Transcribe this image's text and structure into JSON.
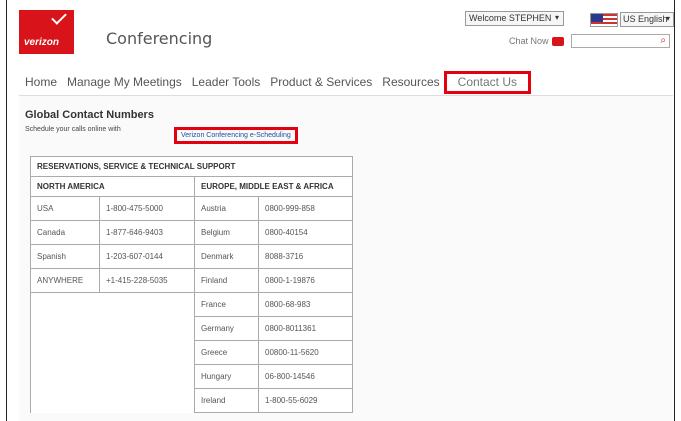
{
  "header": {
    "logo_text": "verizon",
    "app_title": "Conferencing",
    "welcome": "Welcome STEPHEN",
    "language": "US English",
    "chat": "Chat Now",
    "search_placeholder": ""
  },
  "nav": [
    "Home",
    "Manage My Meetings",
    "Leader Tools",
    "Product & Services",
    "Resources",
    "Contact Us"
  ],
  "page": {
    "title": "Global Contact Numbers",
    "schedule_text": "Schedule your calls online with",
    "schedule_link": "Verizon Conferencing e-Scheduling"
  },
  "table": {
    "main_header": "RESERVATIONS, SERVICE & TECHNICAL SUPPORT",
    "left_header": "NORTH AMERICA",
    "right_header": "EUROPE, MIDDLE EAST & AFRICA",
    "north_america": [
      {
        "region": "USA",
        "number": "1-800-475-5000"
      },
      {
        "region": "Canada",
        "number": "1-877-646-9403"
      },
      {
        "region": "Spanish",
        "number": "1-203-607-0144"
      },
      {
        "region": "ANYWHERE",
        "number": "+1-415-228-5035"
      }
    ],
    "emea": [
      {
        "region": "Austria",
        "number": "0800-999-858"
      },
      {
        "region": "Belgium",
        "number": "0800-40154"
      },
      {
        "region": "Denmark",
        "number": "8088-3716"
      },
      {
        "region": "Finland",
        "number": "0800-1-19876"
      },
      {
        "region": "France",
        "number": "0800-68-983"
      },
      {
        "region": "Germany",
        "number": "0800-8011361"
      },
      {
        "region": "Greece",
        "number": "00800-11-5620"
      },
      {
        "region": "Hungary",
        "number": "06-800-14546"
      },
      {
        "region": "Ireland",
        "number": "1-800-55-6029"
      }
    ]
  }
}
